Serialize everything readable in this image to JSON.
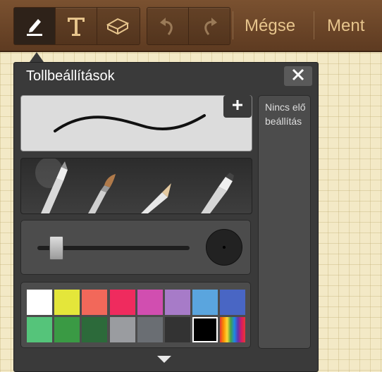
{
  "toolbar": {
    "tools": [
      {
        "name": "pen-tool",
        "icon": "pen-icon",
        "active": true
      },
      {
        "name": "text-tool",
        "icon": "text-t-icon",
        "active": false
      },
      {
        "name": "eraser-tool",
        "icon": "eraser-icon",
        "active": false
      }
    ],
    "history": [
      {
        "name": "undo",
        "icon": "undo-icon"
      },
      {
        "name": "redo",
        "icon": "redo-icon"
      }
    ],
    "cancel_label": "Mégse",
    "save_label": "Ment"
  },
  "panel": {
    "title": "Tollbeállítások",
    "close_icon": "close-icon",
    "add_icon": "plus-icon",
    "presets_empty": "Nincs előbeállítás",
    "pen_types": [
      "pen",
      "brush",
      "pencil",
      "marker"
    ],
    "selected_pen": "pen",
    "size_level": 0.12,
    "colors": [
      "#ffffff",
      "#e4e63a",
      "#f2685a",
      "#ef2b5e",
      "#d14eb0",
      "#a77bc8",
      "#5aa5de",
      "#4966c4",
      "#55c47a",
      "#3a9a44",
      "#2c6a3a",
      "#9a9ca0",
      "#6a6e73",
      "#333333",
      "#000000",
      "rainbow"
    ],
    "selected_color": "#000000"
  }
}
